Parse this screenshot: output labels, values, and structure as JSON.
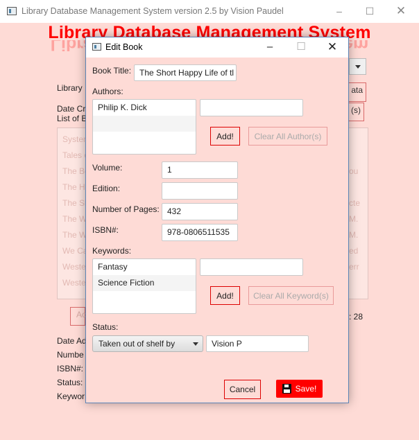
{
  "main_window": {
    "title": "Library Database Management System version 2.5 by Vision Paudel",
    "heading": "Library Database Management System",
    "labels": {
      "library": "Library",
      "date_created": "Date Cr",
      "list_of_books": "List of B",
      "date_added": "Date Ad",
      "number": "Numbe",
      "isbn": "ISBN#:",
      "status": "Status:",
      "keywords": "Keywor",
      "count_value": ": 28"
    },
    "buttons": {
      "data": "ata",
      "s": "(s)",
      "add": "Ac"
    },
    "book_list": [
      "Syster",
      "Tales o",
      "The Bo",
      "The H",
      "The Sh",
      "The W",
      "The W",
      "We Ca",
      "Weste",
      "Weste"
    ],
    "book_list_right": [
      "ou",
      "cte",
      "M.",
      "M.",
      "ed",
      "err"
    ]
  },
  "dialog": {
    "title": "Edit Book",
    "book_title_label": "Book Title:",
    "book_title_value": "The Short Happy Life of tl",
    "authors_label": "Authors:",
    "authors": [
      "Philip K. Dick"
    ],
    "author_input_value": "",
    "add_author_label": "Add!",
    "clear_authors_label": "Clear All Author(s)",
    "volume_label": "Volume:",
    "volume_value": "1",
    "edition_label": "Edition:",
    "edition_value": "",
    "pages_label": "Number of Pages:",
    "pages_value": "432",
    "isbn_label": "ISBN#:",
    "isbn_value": "978-0806511535",
    "keywords_label": "Keywords:",
    "keywords": [
      "Fantasy",
      "Science Fiction"
    ],
    "keyword_input_value": "",
    "add_keyword_label": "Add!",
    "clear_keywords_label": "Clear All Keyword(s)",
    "status_label": "Status:",
    "status_selected": "Taken out of shelf by",
    "status_person_value": "Vision P",
    "cancel_label": "Cancel",
    "save_label": "Save!"
  },
  "colors": {
    "background": "#fedbd6",
    "accent_red": "#ff0000",
    "dialog_border": "#5b84b6"
  },
  "icons": [
    "app-icon",
    "minimize-icon",
    "maximize-icon",
    "close-icon",
    "dropdown-arrow-icon",
    "floppy-disk-icon"
  ]
}
